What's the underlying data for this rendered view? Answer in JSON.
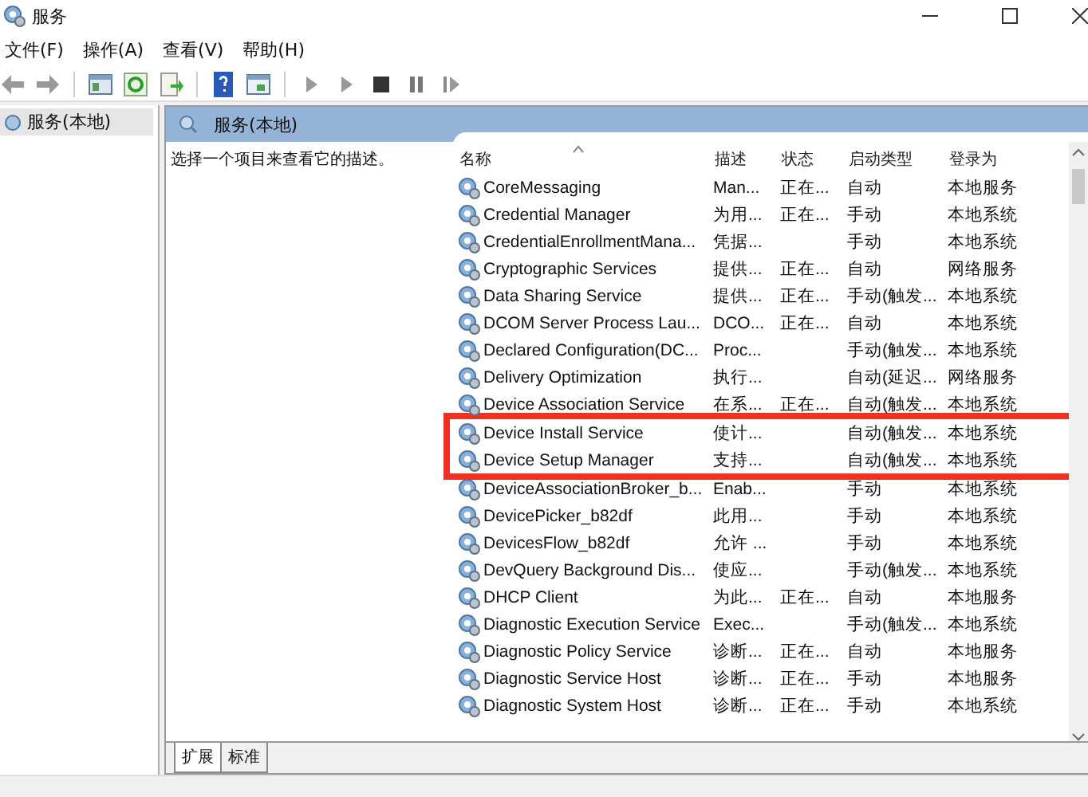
{
  "window": {
    "title": "服务"
  },
  "menu": [
    "文件(F)",
    "操作(A)",
    "查看(V)",
    "帮助(H)"
  ],
  "tree": [
    {
      "label": "服务(本地)",
      "selected": true
    }
  ],
  "panel": {
    "title": "服务(本地)",
    "description": "选择一个项目来查看它的描述。"
  },
  "table": {
    "columns": [
      "名称",
      "描述",
      "状态",
      "启动类型",
      "登录为"
    ],
    "rows": [
      {
        "name": "CoreMessaging",
        "desc": "Man...",
        "status": "正在...",
        "startup": "自动",
        "logon": "本地服务",
        "highlighted": false
      },
      {
        "name": "Credential Manager",
        "desc": "为用...",
        "status": "正在...",
        "startup": "手动",
        "logon": "本地系统",
        "highlighted": false
      },
      {
        "name": "CredentialEnrollmentMana...",
        "desc": "凭据...",
        "status": "",
        "startup": "手动",
        "logon": "本地系统",
        "highlighted": false
      },
      {
        "name": "Cryptographic Services",
        "desc": "提供...",
        "status": "正在...",
        "startup": "自动",
        "logon": "网络服务",
        "highlighted": false
      },
      {
        "name": "Data Sharing Service",
        "desc": "提供...",
        "status": "正在...",
        "startup": "手动(触发...",
        "logon": "本地系统",
        "highlighted": false
      },
      {
        "name": "DCOM Server Process Lau...",
        "desc": "DCO...",
        "status": "正在...",
        "startup": "自动",
        "logon": "本地系统",
        "highlighted": false
      },
      {
        "name": "Declared Configuration(DC...",
        "desc": "Proc...",
        "status": "",
        "startup": "手动(触发...",
        "logon": "本地系统",
        "highlighted": false
      },
      {
        "name": "Delivery Optimization",
        "desc": "执行...",
        "status": "",
        "startup": "自动(延迟...",
        "logon": "网络服务",
        "highlighted": false
      },
      {
        "name": "Device Association Service",
        "desc": "在系...",
        "status": "正在...",
        "startup": "自动(触发...",
        "logon": "本地系统",
        "highlighted": false
      },
      {
        "name": "Device Install Service",
        "desc": "使计...",
        "status": "",
        "startup": "自动(触发...",
        "logon": "本地系统",
        "highlighted": true
      },
      {
        "name": "Device Setup Manager",
        "desc": "支持...",
        "status": "",
        "startup": "自动(触发...",
        "logon": "本地系统",
        "highlighted": true
      },
      {
        "name": "DeviceAssociationBroker_b...",
        "desc": "Enab...",
        "status": "",
        "startup": "手动",
        "logon": "本地系统",
        "highlighted": false
      },
      {
        "name": "DevicePicker_b82df",
        "desc": "此用...",
        "status": "",
        "startup": "手动",
        "logon": "本地系统",
        "highlighted": false
      },
      {
        "name": "DevicesFlow_b82df",
        "desc": "允许 ...",
        "status": "",
        "startup": "手动",
        "logon": "本地系统",
        "highlighted": false
      },
      {
        "name": "DevQuery Background Dis...",
        "desc": "使应...",
        "status": "",
        "startup": "手动(触发...",
        "logon": "本地系统",
        "highlighted": false
      },
      {
        "name": "DHCP Client",
        "desc": "为此...",
        "status": "正在...",
        "startup": "自动",
        "logon": "本地服务",
        "highlighted": false
      },
      {
        "name": "Diagnostic Execution Service",
        "desc": "Exec...",
        "status": "",
        "startup": "手动(触发...",
        "logon": "本地系统",
        "highlighted": false
      },
      {
        "name": "Diagnostic Policy Service",
        "desc": "诊断...",
        "status": "正在...",
        "startup": "自动",
        "logon": "本地服务",
        "highlighted": false
      },
      {
        "name": "Diagnostic Service Host",
        "desc": "诊断...",
        "status": "正在...",
        "startup": "手动",
        "logon": "本地服务",
        "highlighted": false
      },
      {
        "name": "Diagnostic System Host",
        "desc": "诊断...",
        "status": "正在...",
        "startup": "手动",
        "logon": "本地系统",
        "highlighted": false
      }
    ]
  },
  "view_tabs": [
    {
      "label": "扩展",
      "selected": true
    },
    {
      "label": "标准",
      "selected": false
    }
  ]
}
